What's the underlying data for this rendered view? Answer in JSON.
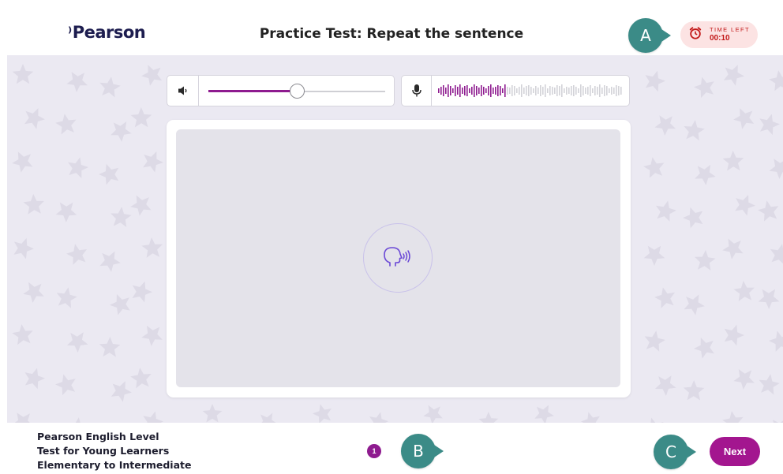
{
  "header": {
    "logo_text": "Pearson",
    "title": "Practice Test: Repeat the sentence",
    "timer": {
      "label": "TIME LEFT",
      "value": "00:10",
      "icon": "alarm-clock-icon",
      "color": "#c21818"
    }
  },
  "callouts": {
    "a": "A",
    "b": "B",
    "c": "C"
  },
  "audio": {
    "volume_icon": "speaker-icon",
    "volume_level": 0.5,
    "mic_icon": "microphone-icon",
    "recording_level": 0.37
  },
  "prompt": {
    "icon": "speaking-head-icon"
  },
  "footer": {
    "test_info": [
      "Pearson English Level",
      "Test for Young Learners",
      "Elementary to Intermediate"
    ],
    "page_number": "1",
    "next_label": "Next"
  },
  "colors": {
    "brand": "#8e1b8f",
    "next_button": "#a3168f",
    "callout": "#3b8b87",
    "background": "#ebe9f2"
  }
}
